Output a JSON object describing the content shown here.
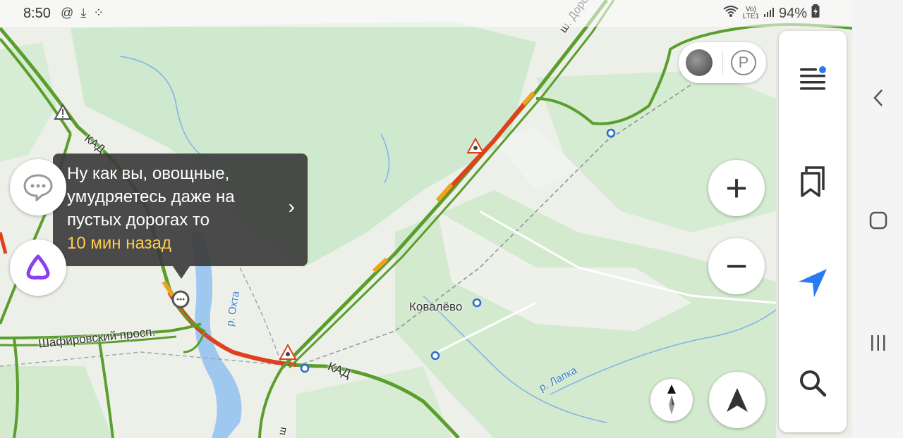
{
  "status_bar": {
    "time": "8:50",
    "icons": [
      "at-icon",
      "download-icon",
      "apps-icon"
    ],
    "network_top": "Vo)",
    "network_bottom": "LTE1",
    "battery": "94%"
  },
  "map": {
    "labels": {
      "kad_1": "КАД",
      "kad_2": "КАД",
      "road_top": "ш. Дорога ж",
      "shafirovsky": "Шафировский просп.",
      "village": "Ковалёво",
      "river_okhta": "р. Охта",
      "river_lapka": "р. Лапка",
      "road_bottom": "ш"
    },
    "colors": {
      "forest": "#cfe9cf",
      "field": "#ecefe6",
      "road_green": "#5a9e2e",
      "road_orange": "#f1a21d",
      "road_red": "#e0401c",
      "water": "#9fc8f0"
    }
  },
  "chat_bubble": {
    "lines": [
      "Ну как вы, овощные,",
      "умудряетесь даже на",
      "пустых дорогах то"
    ],
    "time_ago": "10 мин назад",
    "chevron": "›"
  },
  "controls": {
    "zoom_in": "+",
    "zoom_out": "−",
    "parking": "P"
  },
  "side_panel": {
    "items": [
      "menu-icon",
      "bookmarks-icon",
      "my-location-icon",
      "search-icon"
    ]
  },
  "nav_bar": {
    "items": [
      "back-icon",
      "home-icon",
      "recents-icon"
    ]
  }
}
